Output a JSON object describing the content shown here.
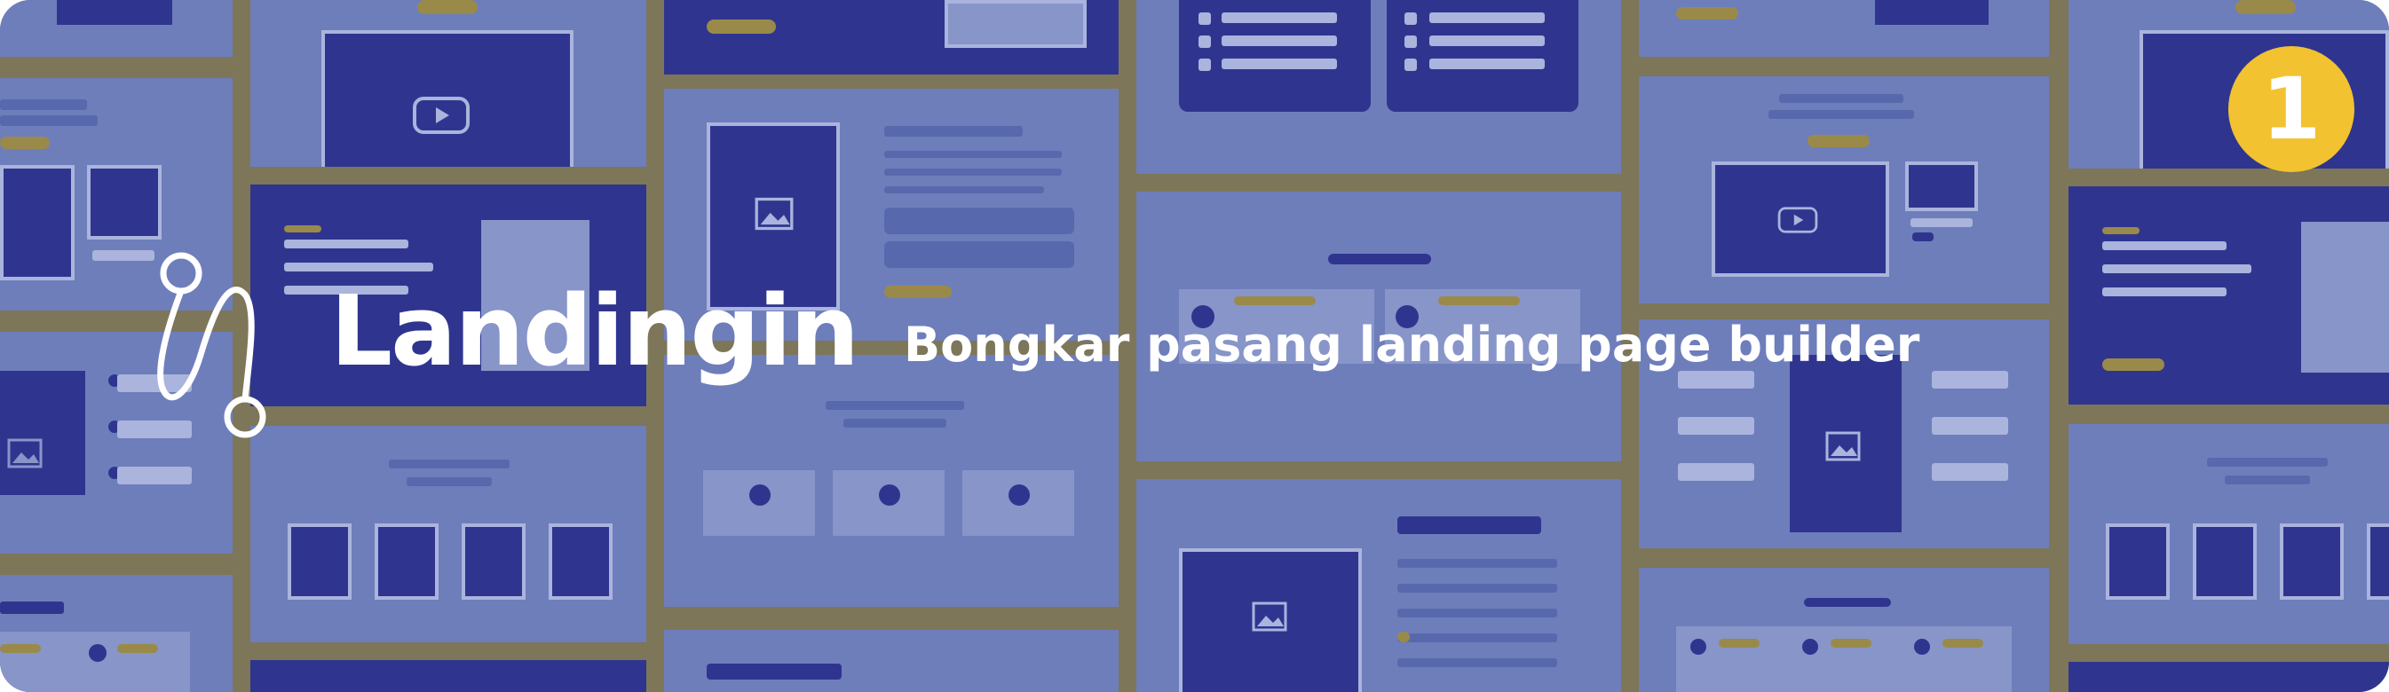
{
  "brand": {
    "name": "Landingin",
    "tagline": "Bongkar pasang landing page builder",
    "logo_icon": "path-connector-icon"
  },
  "badge": {
    "number": "1",
    "color": "#f2c230"
  },
  "colors": {
    "background_gap": "#7d7658",
    "wireframe_tile": "#6e7ebb",
    "wireframe_dark": "#2f358f",
    "accent_gold": "#9a8a4a",
    "text": "#ffffff"
  },
  "background_icons": [
    "play-icon",
    "image-icon"
  ]
}
